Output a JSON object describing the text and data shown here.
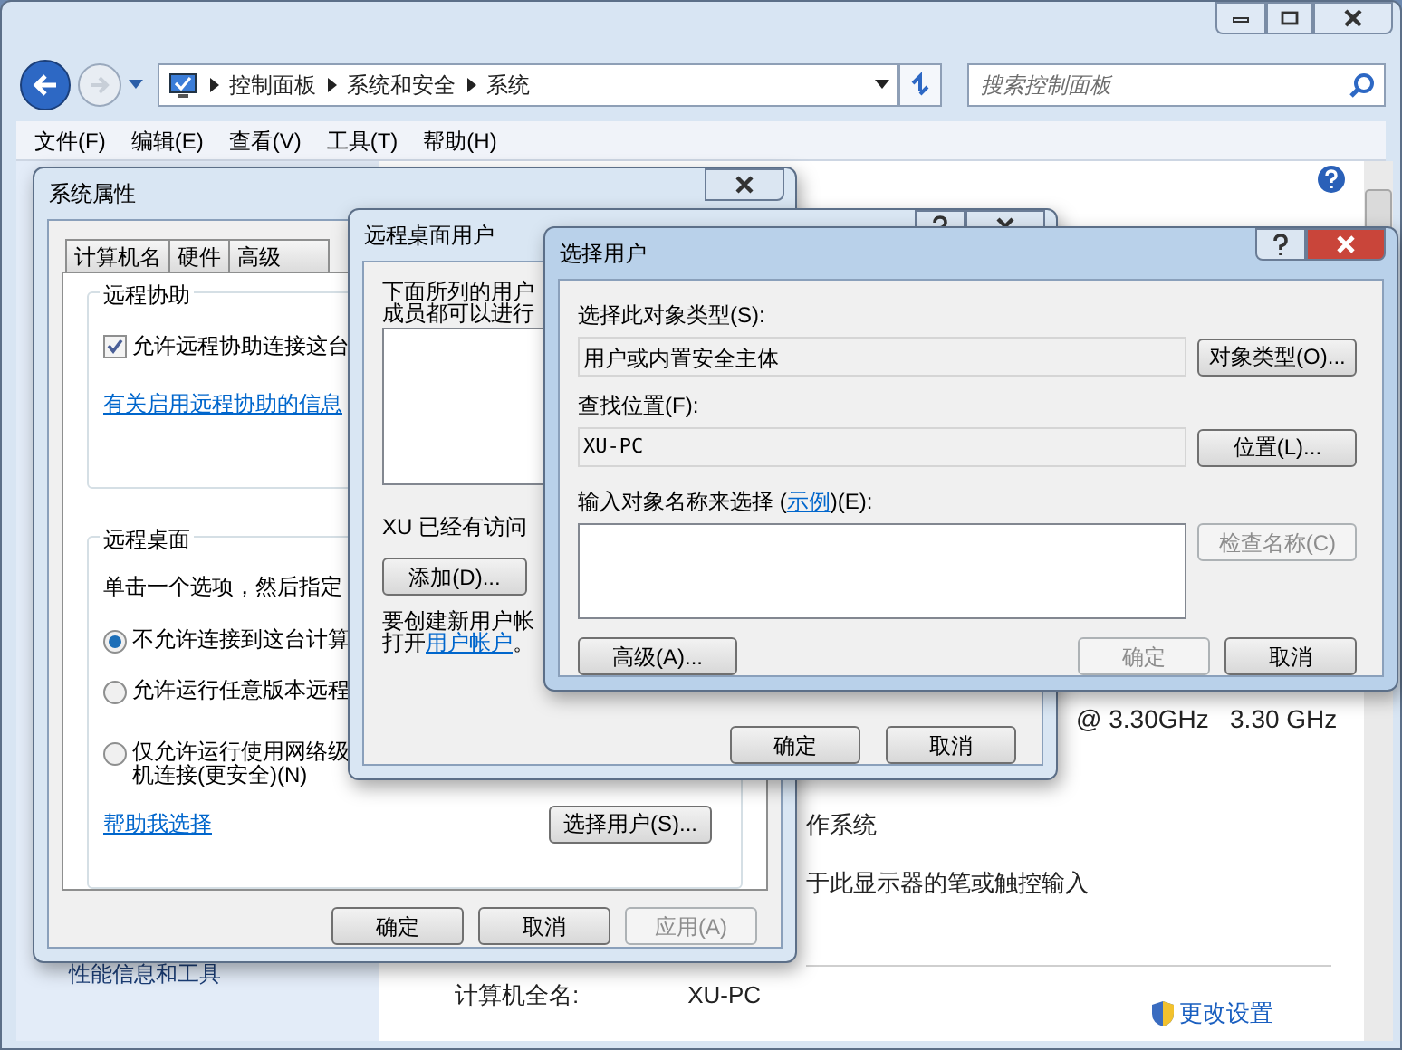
{
  "explorer": {
    "breadcrumb": [
      "控制面板",
      "系统和安全",
      "系统"
    ],
    "search": {
      "placeholder": "搜索控制面板"
    },
    "menu": [
      "文件(F)",
      "编辑(E)",
      "查看(V)",
      "工具(T)",
      "帮助(H)"
    ],
    "sidebar_items": [
      "性能信息和工具"
    ],
    "processor": "@ 3.30GHz   3.30 GHz",
    "system_type": "作系统",
    "pen_touch": "于此显示器的笔或触控输入",
    "change_settings": "更改设置",
    "computer_full_name": {
      "label": "计算机全名:",
      "value": "XU-PC"
    }
  },
  "system_properties": {
    "title": "系统属性",
    "tabs": [
      {
        "label": "计算机名",
        "selected": false
      },
      {
        "label": "硬件",
        "selected": false
      },
      {
        "label": "高级",
        "selected": false
      }
    ],
    "remote_assistance": {
      "title": "远程协助",
      "checkbox": {
        "label": "允许远程协助连接这台",
        "checked": true
      },
      "link": "有关启用远程协助的信息"
    },
    "remote_desktop": {
      "title": "远程桌面",
      "intro": "单击一个选项，然后指定",
      "options": [
        {
          "lines": [
            "不允许连接到这台计算"
          ],
          "selected": true
        },
        {
          "lines": [
            "允许运行任意版本远程"
          ],
          "selected": false
        },
        {
          "lines": [
            "仅允许运行使用网络级",
            "机连接(更安全)(N)"
          ],
          "selected": false
        }
      ],
      "link": "帮助我选择",
      "button": "选择用户(S)..."
    },
    "buttons": [
      {
        "label": "确定",
        "disabled": false
      },
      {
        "label": "取消",
        "disabled": false
      },
      {
        "label": "应用(A)",
        "disabled": true
      }
    ]
  },
  "remote_desktop_users": {
    "title": "远程桌面用户",
    "intro": [
      "下面所列的用户",
      "成员都可以进行"
    ],
    "access_note": "XU 已经有访问",
    "add_button": "添加(D)...",
    "create_note": {
      "line_1": "要创建新用户帐",
      "line_2_prefix": "打开",
      "link": "用户帐户",
      "line_2_suffix": "。"
    },
    "buttons": [
      {
        "label": "确定",
        "disabled": false
      },
      {
        "label": "取消",
        "disabled": false
      }
    ]
  },
  "select_users": {
    "title": "选择用户",
    "object_type": {
      "label": "选择此对象类型(S):",
      "value": "用户或内置安全主体",
      "button": "对象类型(O)..."
    },
    "location": {
      "label": "查找位置(F):",
      "value": "XU-PC",
      "button": "位置(L)..."
    },
    "names": {
      "label_prefix": "输入对象名称来选择 (",
      "label_link": "示例",
      "label_suffix": ")(E):",
      "check_button": {
        "label": "检查名称(C)",
        "disabled": true
      }
    },
    "advanced_button": "高级(A)...",
    "buttons": [
      {
        "label": "确定",
        "disabled": true
      },
      {
        "label": "取消",
        "disabled": false
      }
    ]
  }
}
